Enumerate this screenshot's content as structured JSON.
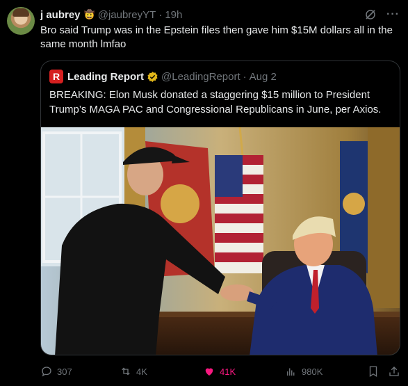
{
  "post": {
    "author_name": "j aubrey",
    "author_emoji": "🤠",
    "handle": "@jaubreyYT",
    "separator": "·",
    "time": "19h",
    "text": "Bro said Trump was in the Epstein files then gave him $15M dollars all in the same month lmfao",
    "more_label": "···"
  },
  "quote": {
    "logo_letter": "R",
    "name": "Leading Report",
    "handle": "@LeadingReport",
    "separator": "·",
    "date": "Aug 2",
    "text": "BREAKING: Elon Musk donated a staggering $15 million to President Trump’s MAGA PAC and Congressional Republicans in June, per Axios."
  },
  "stats": {
    "replies": "307",
    "reposts": "4K",
    "likes": "41K",
    "views": "980K"
  },
  "colors": {
    "background": "#000000",
    "text": "#e7e9ea",
    "secondary": "#71767b",
    "border": "#2f3336",
    "like": "#f91880",
    "verified": "#e2b719",
    "logo": "#d62020"
  },
  "icons": [
    "grok-icon",
    "more-icon",
    "verified-icon",
    "reply-icon",
    "repost-icon",
    "heart-icon",
    "views-icon",
    "bookmark-icon",
    "share-icon"
  ]
}
